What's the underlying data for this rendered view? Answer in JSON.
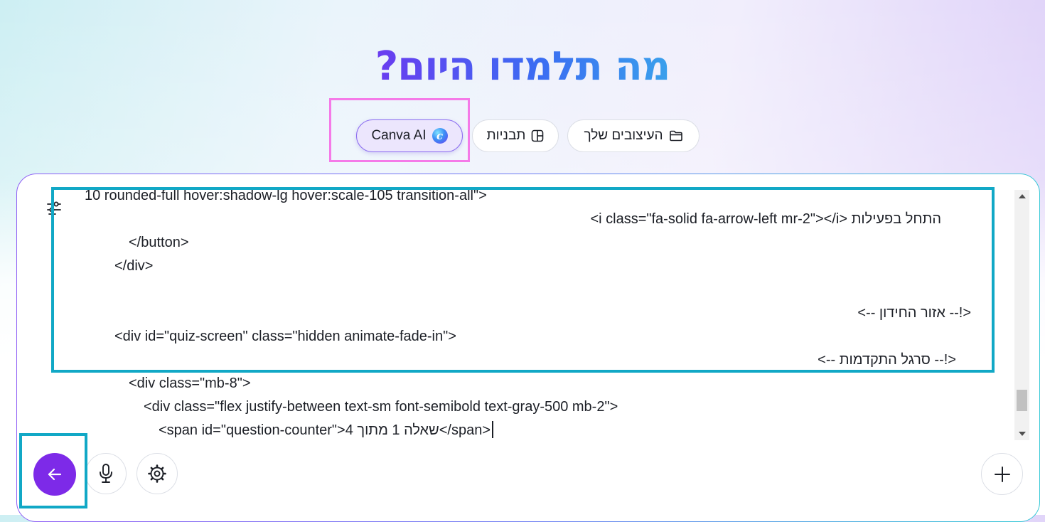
{
  "page": {
    "headline": "מה תלמדו היום?"
  },
  "tabs": [
    {
      "label": "Canva AI",
      "icon": "canva-ai-icon",
      "selected": true
    },
    {
      "label": "תבניות",
      "icon": "templates-icon",
      "selected": false
    },
    {
      "label": "העיצובים שלך",
      "icon": "folder-icon",
      "selected": false
    }
  ],
  "composer": {
    "lines": [
      "10 rounded-full hover:shadow-lg hover:scale-105 transition-all\">",
      "התחל בפעילות <i class=\"fa-solid fa-arrow-left mr-2\"></i>",
      "</button>",
      "</div>",
      "<!-- אזור החידון -->",
      "<div id=\"quiz-screen\" class=\"hidden animate-fade-in\">",
      "<!-- סרגל התקדמות -->",
      "<div class=\"mb-8\">",
      "<div class=\"flex justify-between text-sm font-semibold text-gray-500 mb-2\">",
      "<span id=\"question-counter\">שאלה 1 מתוך 4</span>"
    ],
    "scroll_position": 0.92
  },
  "icons": {
    "filter": "sliders-icon",
    "send": "arrow-left-icon",
    "mic": "microphone-icon",
    "settings": "gear-icon",
    "add": "plus-icon"
  },
  "colors": {
    "accent": "#7d2ae8",
    "annotation_pink": "#f57ae8",
    "annotation_teal": "#11a8c6"
  }
}
